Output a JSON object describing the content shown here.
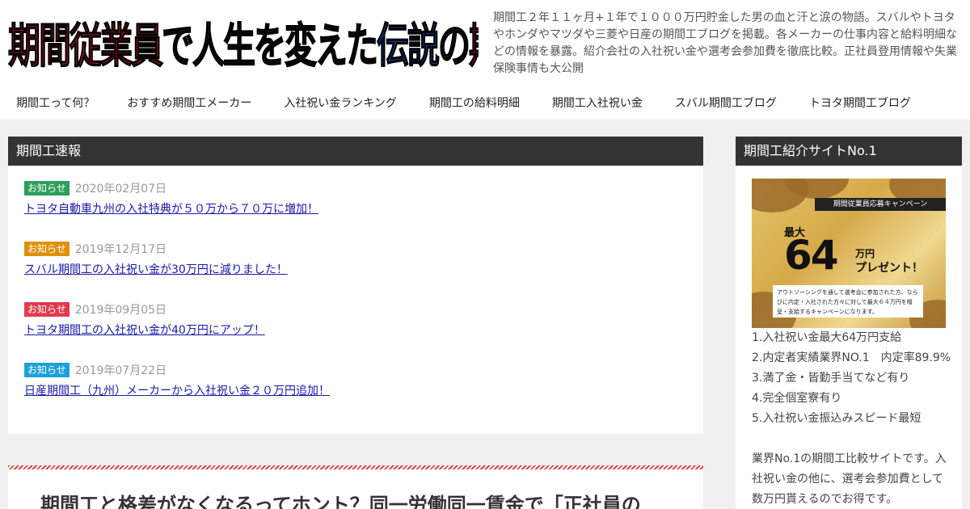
{
  "header": {
    "logo_parts": [
      {
        "text": "期間従業員",
        "color": "red"
      },
      {
        "text": "で人生を変えた",
        "color": "black"
      },
      {
        "text": "伝説",
        "color": "blue"
      },
      {
        "text": "の",
        "color": "black"
      },
      {
        "text": "期間エブログ",
        "color": "red"
      }
    ],
    "tagline": "期間工２年１１ヶ月+１年で１０００万円貯金した男の血と汗と涙の物語。スバルやトヨタやホンダやマツダや三菱や日産の期間工ブログを掲載。各メーカーの仕事内容と給料明細などの情報を暴露。紹介会社の入社祝い金や選考会参加費を徹底比較。正社員登用情報や失業保険事情も大公開"
  },
  "nav": {
    "items": [
      "期間工って何？",
      "おすすめ期間工メーカー",
      "入社祝い金ランキング",
      "期間工の給料明細",
      "期間工入社祝い金",
      "スバル期間工ブログ",
      "トヨタ期間工ブログ"
    ]
  },
  "news": {
    "title": "期間工速報",
    "items": [
      {
        "badge": "お知らせ",
        "badge_color": "#2e9e5b",
        "date": "2020年02月07日",
        "text": "トヨタ自動車九州の入社特典が５０万から７０万に増加！"
      },
      {
        "badge": "お知らせ",
        "badge_color": "#e0900c",
        "date": "2019年12月17日",
        "text": "スバル期間工の入社祝い金が30万円に減りました！"
      },
      {
        "badge": "お知らせ",
        "badge_color": "#e23b4e",
        "date": "2019年09月05日",
        "text": "トヨタ期間工の入社祝い金が40万円にアップ！"
      },
      {
        "badge": "お知らせ",
        "badge_color": "#1ea0d8",
        "date": "2019年07月22日",
        "text": "日産期間工（九州）メーカーから入社祝い金２０万円追加！"
      }
    ]
  },
  "article": {
    "title": "期間工と格差がなくなるってホント？同一労働同一賃金で「正社員の"
  },
  "sidebar": {
    "title": "期間工紹介サイトNo.1",
    "banner": {
      "ribbon": "期間従業員応募キャンペーン",
      "max": "最大",
      "amount": "64",
      "unit": "万円",
      "present": "プレゼント！",
      "note": "アウトソーシングを通して選考会に参加された方、ならびに内定・入社された方々に対して最大６４万円を贈呈・支給するキャンペーンになります。"
    },
    "features": [
      "1.入社祝い金最大64万円支給",
      "2.内定者実績業界NO.1　内定率89.9%",
      "3.満了金・皆勤手当てなど有り",
      "4.完全個室寮有り",
      "5.入社祝い金振込みスピード最短"
    ],
    "description": "業界No.1の期間工比較サイトです。入社祝い金の他に、選考会参加費として数万円貰えるのでお得です。"
  }
}
